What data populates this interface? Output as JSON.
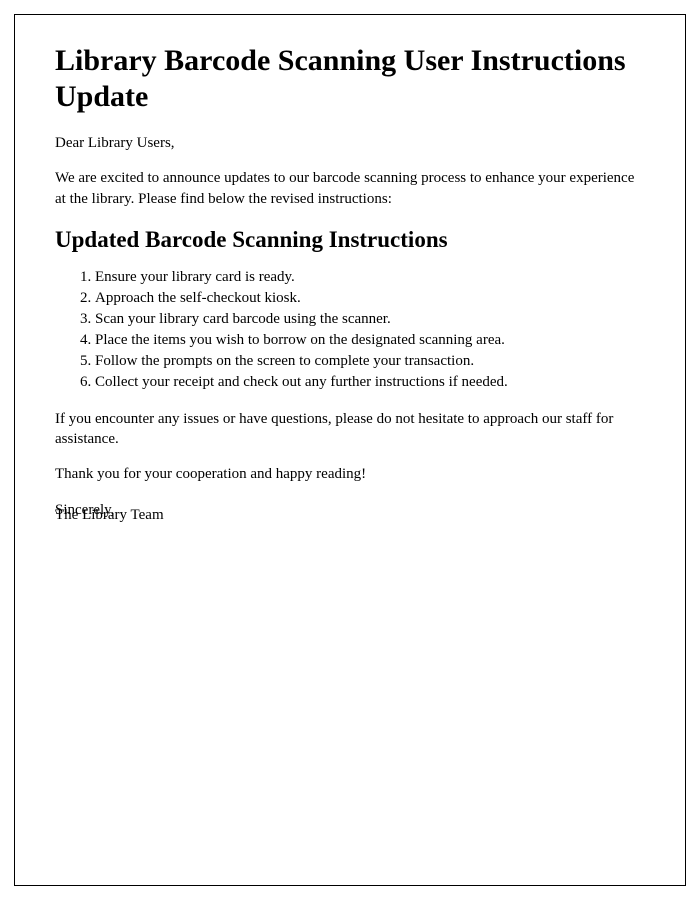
{
  "title": "Library Barcode Scanning User Instructions Update",
  "salutation": "Dear Library Users,",
  "intro": "We are excited to announce updates to our barcode scanning process to enhance your experience at the library. Please find below the revised instructions:",
  "subheading": "Updated Barcode Scanning Instructions",
  "steps": [
    "Ensure your library card is ready.",
    "Approach the self-checkout kiosk.",
    "Scan your library card barcode using the scanner.",
    "Place the items you wish to borrow on the designated scanning area.",
    "Follow the prompts on the screen to complete your transaction.",
    "Collect your receipt and check out any further instructions if needed."
  ],
  "assist": "If you encounter any issues or have questions, please do not hesitate to approach our staff for assistance.",
  "thanks": "Thank you for your cooperation and happy reading!",
  "signoff": "Sincerely,",
  "team": "The Library Team"
}
